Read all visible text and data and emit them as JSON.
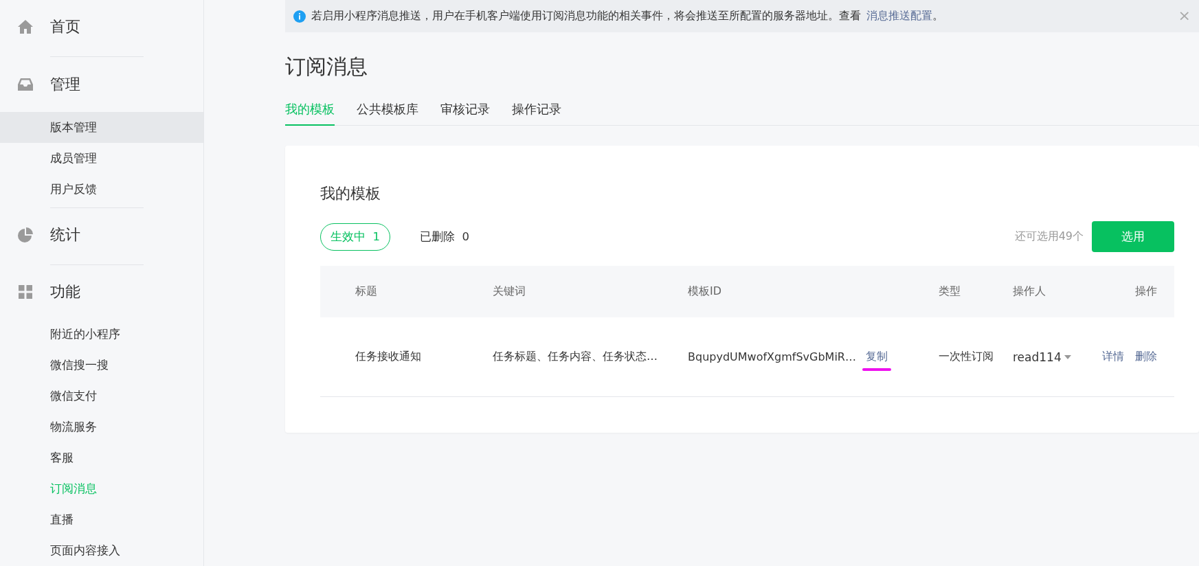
{
  "sidebar": {
    "sections": [
      {
        "title": "首页"
      },
      {
        "title": "管理",
        "items": [
          {
            "label": "版本管理",
            "selected": false,
            "hovered": true
          },
          {
            "label": "成员管理",
            "selected": false,
            "hovered": false
          },
          {
            "label": "用户反馈",
            "selected": false,
            "hovered": false
          }
        ]
      },
      {
        "title": "统计"
      },
      {
        "title": "功能",
        "items": [
          {
            "label": "附近的小程序",
            "selected": false,
            "hovered": false
          },
          {
            "label": "微信搜一搜",
            "selected": false,
            "hovered": false
          },
          {
            "label": "微信支付",
            "selected": false,
            "hovered": false
          },
          {
            "label": "物流服务",
            "selected": false,
            "hovered": false
          },
          {
            "label": "客服",
            "selected": false,
            "hovered": false
          },
          {
            "label": "订阅消息",
            "selected": true,
            "hovered": false
          },
          {
            "label": "直播",
            "selected": false,
            "hovered": false
          },
          {
            "label": "页面内容接入",
            "selected": false,
            "hovered": false
          }
        ]
      }
    ]
  },
  "notice": {
    "text": "若启用小程序消息推送，用户在手机客户端使用订阅消息功能的相关事件，将会推送至所配置的服务器地址。查看",
    "link": "消息推送配置",
    "end": "。",
    "close": "×"
  },
  "page_title": "订阅消息",
  "tabs": [
    {
      "label": "我的模板",
      "selected": true
    },
    {
      "label": "公共模板库",
      "selected": false
    },
    {
      "label": "审核记录",
      "selected": false
    },
    {
      "label": "操作记录",
      "selected": false
    }
  ],
  "card": {
    "title": "我的模板",
    "filters": [
      {
        "label": "生效中",
        "count": "1",
        "selected": true
      },
      {
        "label": "已删除",
        "count": "0",
        "selected": false
      }
    ],
    "remaining": "还可选用49个",
    "select_button": "选用",
    "table": {
      "columns": [
        "标题",
        "关键词",
        "模板ID",
        "类型",
        "操作人",
        "操作"
      ],
      "rows": [
        {
          "title": "任务接收通知",
          "keywords": "任务标题、任务内容、任务状态…",
          "template_id": "BqupydUMwofXgmfSvGbMiR…",
          "copy": "复制",
          "type": "一次性订阅",
          "operator": "read114",
          "actions": [
            "详情",
            "删除"
          ]
        }
      ]
    }
  }
}
